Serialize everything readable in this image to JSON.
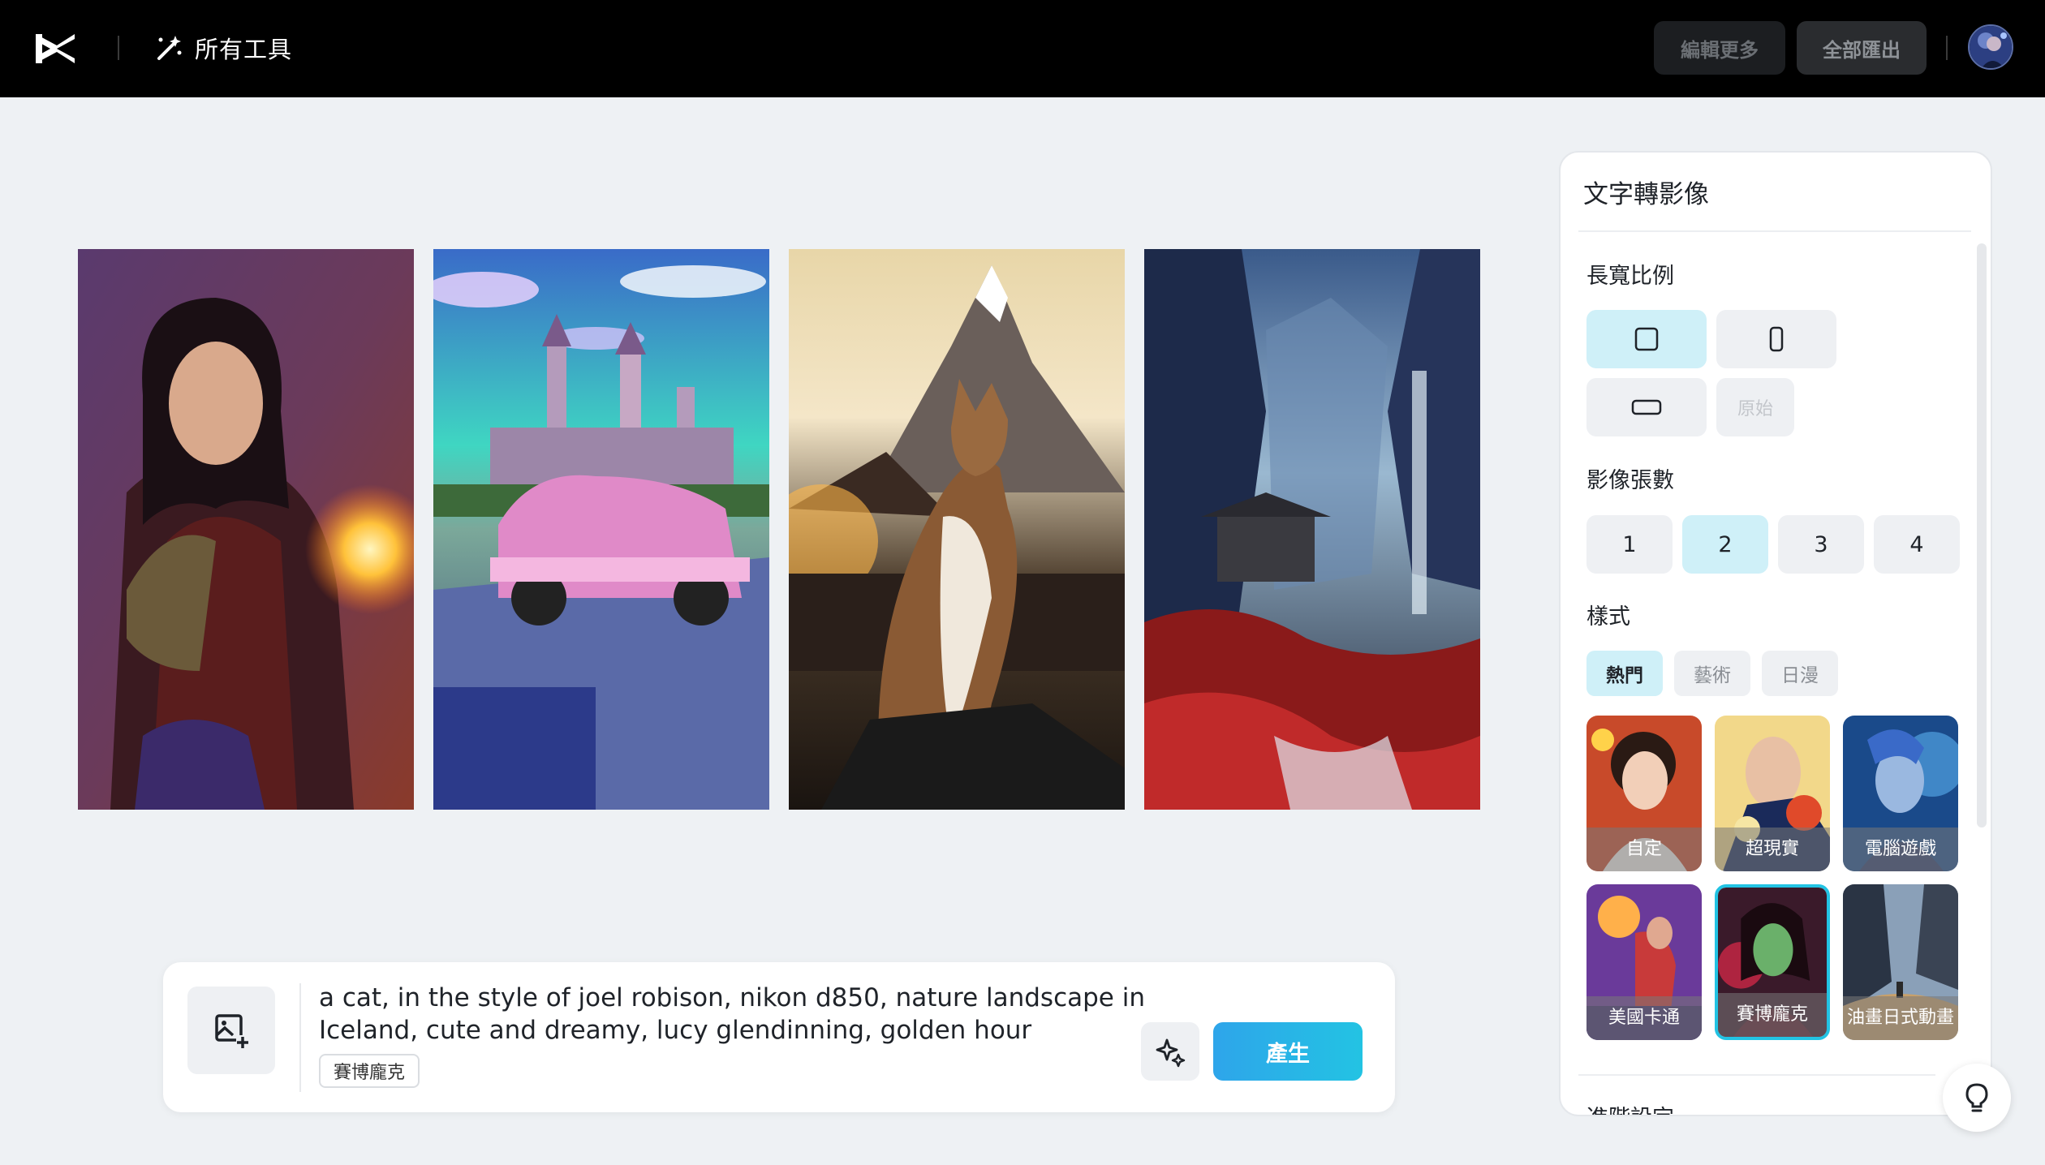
{
  "topbar": {
    "logo_icon": "capcut-logo-icon",
    "tools_icon": "magic-wand-icon",
    "tools_label": "所有工具",
    "edit_more_label": "編輯更多",
    "export_all_label": "全部匯出",
    "avatar_icon": "user-avatar"
  },
  "gallery": {
    "images": [
      {
        "icon": "fantasy-woman-fireball-image"
      },
      {
        "icon": "pink-car-castle-image"
      },
      {
        "icon": "cat-mountain-sunset-image"
      },
      {
        "icon": "asian-mountain-temple-image"
      }
    ]
  },
  "prompt": {
    "upload_icon": "image-add-icon",
    "text_line1": "a cat, in the style of joel robison, nikon d850, nature landscape in",
    "text_line2": "Iceland, cute and dreamy, lucy glendinning, golden hour",
    "style_tag": "賽博龐克",
    "enhance_icon": "sparkle-icon",
    "generate_label": "產生"
  },
  "panel": {
    "title": "文字轉影像",
    "aspect_label": "長寬比例",
    "aspect_options": [
      {
        "icon": "square-icon",
        "selected": true
      },
      {
        "icon": "portrait-icon",
        "selected": false
      },
      {
        "icon": "landscape-icon",
        "selected": false
      },
      {
        "label": "原始",
        "selected": false
      }
    ],
    "count_label": "影像張數",
    "counts": [
      "1",
      "2",
      "3",
      "4"
    ],
    "count_selected": "2",
    "style_label": "樣式",
    "style_tabs": [
      "熱門",
      "藝術",
      "日漫"
    ],
    "style_tab_selected": "熱門",
    "styles": [
      {
        "label": "自定",
        "selected": false
      },
      {
        "label": "超現實",
        "selected": false
      },
      {
        "label": "電腦遊戲",
        "selected": false
      },
      {
        "label": "美國卡通",
        "selected": false
      },
      {
        "label": "賽博龐克",
        "selected": true
      },
      {
        "label": "油畫日式動畫",
        "selected": false
      }
    ],
    "advanced_label": "進階設定",
    "help_icon": "lightbulb-icon"
  },
  "colors": {
    "accent": "#22c3e3",
    "selected_bg": "#cff0f8",
    "topbar_bg": "#000000",
    "page_bg": "#eef1f4"
  }
}
